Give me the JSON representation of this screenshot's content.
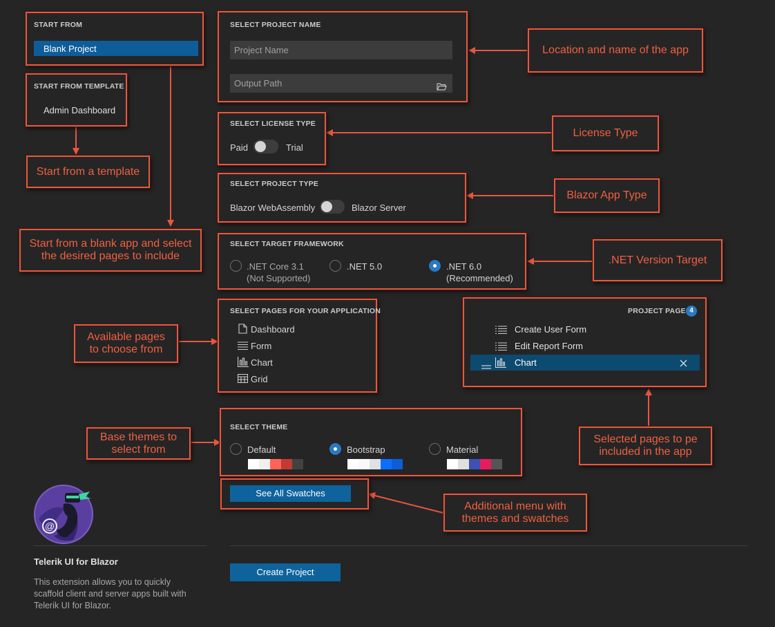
{
  "start_from": {
    "header": "START FROM",
    "selected": "Blank Project"
  },
  "start_from_template": {
    "header": "START FROM TEMPLATE",
    "selected": "Admin Dashboard"
  },
  "project_name": {
    "header": "SELECT PROJECT NAME",
    "name_placeholder": "Project Name",
    "path_placeholder": "Output Path"
  },
  "license": {
    "header": "SELECT LICENSE TYPE",
    "left": "Paid",
    "right": "Trial"
  },
  "project_type": {
    "header": "SELECT PROJECT TYPE",
    "left": "Blazor WebAssembly",
    "right": "Blazor Server"
  },
  "framework": {
    "header": "SELECT TARGET FRAMEWORK",
    "options": [
      {
        "label": ".NET Core 3.1",
        "note": "(Not Supported)",
        "selected": false
      },
      {
        "label": ".NET 5.0",
        "note": "",
        "selected": false
      },
      {
        "label": ".NET 6.0",
        "note": "(Recommended)",
        "selected": true
      }
    ]
  },
  "pages": {
    "header": "SELECT PAGES FOR YOUR APPLICATION",
    "items": [
      "Dashboard",
      "Form",
      "Chart",
      "Grid"
    ]
  },
  "project_pages": {
    "header": "PROJECT PAGES",
    "count": "4",
    "items": [
      "Create User Form",
      "Edit Report Form",
      "Chart"
    ]
  },
  "theme": {
    "header": "SELECT THEME",
    "options": [
      {
        "label": "Default",
        "selected": false,
        "swatches": [
          "#ffffff",
          "#f0f0f0",
          "#ff6358",
          "#c33a33",
          "#424242"
        ]
      },
      {
        "label": "Bootstrap",
        "selected": true,
        "swatches": [
          "#ffffff",
          "#f8f9fa",
          "#dee2e6",
          "#0d6efd",
          "#0b5ed7"
        ]
      },
      {
        "label": "Material",
        "selected": false,
        "swatches": [
          "#ffffff",
          "#e0e0e0",
          "#3f51b5",
          "#e51d5e",
          "#555555"
        ]
      }
    ]
  },
  "buttons": {
    "see_all_swatches": "See All Swatches",
    "create_project": "Create Project"
  },
  "branding": {
    "title": "Telerik UI for Blazor",
    "description": [
      "This extension allows you to quickly",
      "scaffold client and server apps built with",
      "Telerik UI for Blazor."
    ]
  },
  "annotations": {
    "location_name": "Location and name of the app",
    "license_type": "License Type",
    "blazor_app_type": "Blazor App Type",
    "net_version": ".NET Version Target",
    "start_template": "Start from a template",
    "start_blank": [
      "Start from a blank app and select",
      "the desired pages to include"
    ],
    "available_pages": [
      "Available pages",
      "to choose from"
    ],
    "selected_pages": [
      "Selected pages to pe",
      "included in the app"
    ],
    "base_themes": [
      "Base themes to",
      "select from"
    ],
    "additional_menu": [
      "Additional menu with",
      "themes and swatches"
    ]
  },
  "colors": {
    "accent": "#e8573f",
    "primary": "#0e639c",
    "background": "#252526",
    "input": "#3c3c3c"
  }
}
